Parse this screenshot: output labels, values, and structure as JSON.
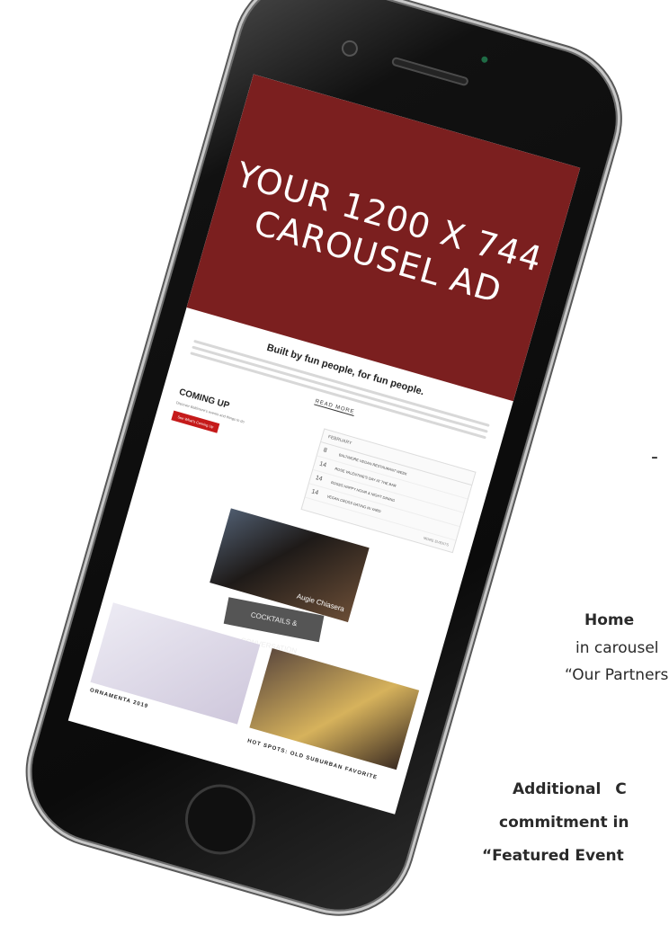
{
  "side_text": {
    "dash": "-",
    "home": "Home",
    "incarousel": "in carousel",
    "ourpartners": "“Our Partners",
    "additional": "Additional C",
    "commitment": "commitment in",
    "featured": "“Featured Event"
  },
  "phone": {
    "screen": {
      "ad": {
        "text": "YOUR 1200 X 744 CAROUSEL AD",
        "color": "#7b1f1f"
      },
      "about": {
        "tagline": "Built by fun people, for fun people.",
        "read_more": "READ MORE"
      },
      "coming_up": {
        "title": "COMING UP",
        "description": "Discover Baltimore's events and things to do",
        "button": "See What's Coming Up"
      },
      "calendar": {
        "month": "FEBRUARY",
        "events": [
          {
            "date": "8",
            "name": "BALTIMORE VEGAN RESTAURANT WEEK"
          },
          {
            "date": "14",
            "name": "ROSE VALENTINE'S DAY AT THE BAR"
          },
          {
            "date": "14",
            "name": "ROSES HAPPY HOUR & NIGHT DINING"
          },
          {
            "date": "14",
            "name": "VEGAN CROSS DATING IN YARD"
          }
        ],
        "more_label": "MORE EVENTS"
      },
      "video": {
        "caption": "Augie Chiasera"
      },
      "cocktails": {
        "title": "COCKTAILS & CONVERSATION"
      },
      "gallery": [
        {
          "title": "ORNAMENTA 2019"
        },
        {
          "title": "HOT SPOTS: OLD SUBURBAN FAVORITE"
        }
      ]
    }
  }
}
